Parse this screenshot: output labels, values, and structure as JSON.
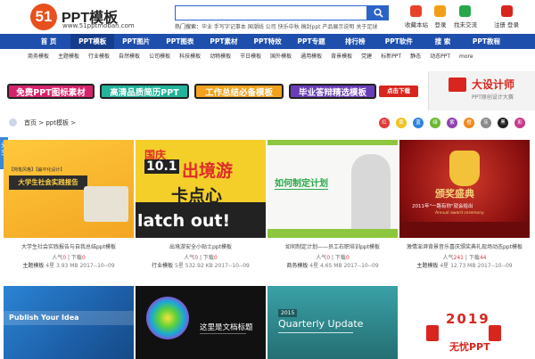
{
  "header": {
    "logo_mark": "51",
    "logo_name": "PPT模板",
    "logo_url": "www.51pptmoban.com",
    "search_placeholder": "",
    "hot_label": "热门搜索：",
    "hot_terms": "毕业 手写字记事本 国潮线 公司 快乐中秋 稿封ppt 产品展示说明 关于足球",
    "top_links": [
      {
        "label": "收藏本站",
        "color": "#e8422d"
      },
      {
        "label": "登录",
        "color": "#f39e1a"
      },
      {
        "label": "找未交流",
        "color": "#28a84a"
      },
      {
        "label": "注册 登录",
        "color": "#d8261e"
      }
    ]
  },
  "nav": {
    "items": [
      "首 页",
      "PPT模板",
      "PPT图片",
      "PPT图表",
      "PPT素材",
      "PPT特效",
      "PPT专题",
      "排行榜",
      "PPT软件",
      "搜 索",
      "PPT教程"
    ],
    "active_index": 1
  },
  "subnav": {
    "items": [
      "商务模板",
      "主题模板",
      "行业模板",
      "自然模板",
      "公司模板",
      "科技模板",
      "动物模板",
      "节日模板",
      "国外模板",
      "通用模板",
      "背景模板",
      "党建",
      "标新PPT",
      "静态",
      "动态PPT",
      "more"
    ]
  },
  "banner": {
    "pills": [
      {
        "label": "免费PPT图标素材",
        "color": "#d6246b"
      },
      {
        "label": "高清品质简历PPT",
        "color": "#22b39a"
      },
      {
        "label": "工作总结必备模板",
        "color": "#f2a21d"
      },
      {
        "label": "毕业答辩精选模板",
        "color": "#6a3db8"
      }
    ],
    "cta": "点击下载",
    "right_title": "大设计师",
    "right_sub": "PPT原创设计大赛"
  },
  "breadcrumb": {
    "home": "首页",
    "current": "ppt模板"
  },
  "color_filters": [
    {
      "label": "红",
      "color": "#e03a3a"
    },
    {
      "label": "黄",
      "color": "#f1c21f"
    },
    {
      "label": "蓝",
      "color": "#2e84d8"
    },
    {
      "label": "绿",
      "color": "#6ab732"
    },
    {
      "label": "紫",
      "color": "#8e44ad"
    },
    {
      "label": "橙",
      "color": "#f08a1c"
    },
    {
      "label": "灰",
      "color": "#8a8a8a"
    },
    {
      "label": "黑",
      "color": "#222222"
    },
    {
      "label": "彩",
      "color": "#c53a8c"
    }
  ],
  "side_tab": "分享",
  "cards": [
    {
      "title": "大学生社会实践报告与自我总结ppt模板",
      "views_label": "人气",
      "views": "0",
      "downloads_label": "下载",
      "downloads": "0",
      "category": "主题模板",
      "stars": "4星",
      "size": "3.93 MB",
      "date": "2017--10--09",
      "thumb_heading": "大学生社会实践报告",
      "thumb_tag": "【简笔风格】【扁平化设计】"
    },
    {
      "title": "出境游安全小贴士ppt模板",
      "views_label": "人气",
      "views": "0",
      "downloads_label": "下载",
      "downloads": "0",
      "category": "行业模板",
      "stars": "5星",
      "size": "532.92 KB",
      "date": "2017--10--09",
      "thumb_heading": "出境游",
      "thumb_line1": "国庆",
      "thumb_line2": "10.1",
      "thumb_line3": "卡点心",
      "thumb_line4": "latch out!"
    },
    {
      "title": "如何制定计划——员工右职培训ppt模板",
      "views_label": "人气",
      "views": "0",
      "downloads_label": "下载",
      "downloads": "0",
      "category": "商务模板",
      "stars": "4星",
      "size": "4.65 MB",
      "date": "2017--10--09",
      "thumb_heading": "如何制定计划"
    },
    {
      "title": "激情澎湃背景音乐喜庆颁奖典礼现场动态ppt模板",
      "views_label": "人气",
      "views": "241",
      "downloads_label": "下载",
      "downloads": "44",
      "category": "主题模板",
      "stars": "4星",
      "size": "12.73 MB",
      "date": "2017--10--09",
      "thumb_heading": "颁奖盛典",
      "thumb_sub": "2011年\"一路有你\"就会给出",
      "thumb_sub2": "Annual award ceremony"
    },
    {
      "thumb_heading": "Publish Your Idea"
    },
    {
      "thumb_heading": "这里是文档标题"
    },
    {
      "thumb_year": "2015",
      "thumb_heading": "Quarterly Update"
    },
    {
      "thumb_year": "2019",
      "thumb_heading": "无忧PPT"
    }
  ]
}
